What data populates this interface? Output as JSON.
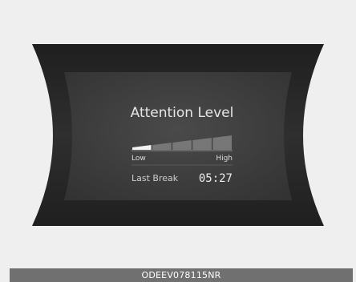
{
  "display": {
    "title": "Attention Level",
    "gauge": {
      "low_label": "Low",
      "high_label": "High",
      "level_fraction": 0.2,
      "segments_total": 5,
      "segments_filled": 1
    },
    "last_break": {
      "label": "Last Break",
      "value": "05:27"
    }
  },
  "caption": "ODEEV078115NR",
  "colors": {
    "page_bg": "#efefef",
    "frame": "#2b2b2b",
    "panel": "#3b3b3b",
    "text": "#e6e6e6",
    "segment_on": "#f2f2f2",
    "segment_off": "#777777",
    "caption_bar": "#707070"
  }
}
